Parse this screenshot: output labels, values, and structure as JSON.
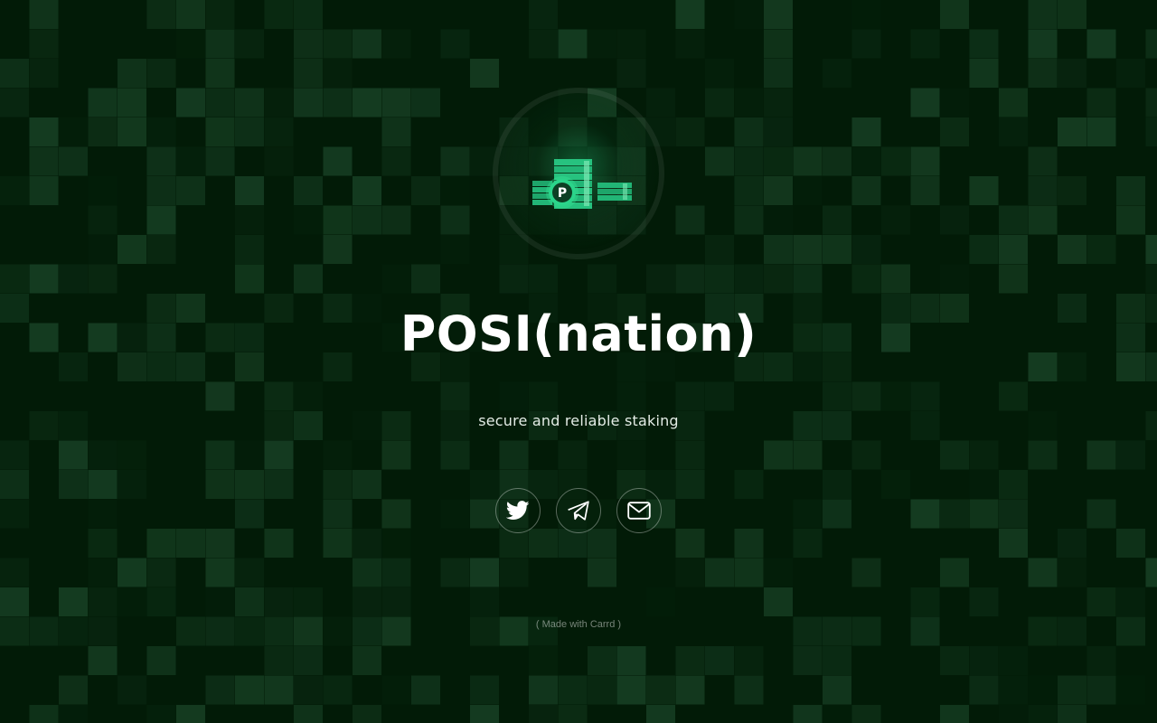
{
  "site": {
    "title": "POSI(nation)",
    "subtitle": "secure and reliable staking",
    "logo_icon": "posi-coin-stacks-icon",
    "logo_letter": "P"
  },
  "socials": [
    {
      "name": "twitter",
      "icon": "twitter-bird-icon"
    },
    {
      "name": "telegram",
      "icon": "telegram-plane-icon"
    },
    {
      "name": "email",
      "icon": "envelope-icon"
    }
  ],
  "footer": {
    "credit": "( Made with Carrd )"
  },
  "colors": {
    "background": "#021b07",
    "tile": "#2f6a45",
    "accent": "#2ecf85",
    "text": "#ffffff"
  }
}
